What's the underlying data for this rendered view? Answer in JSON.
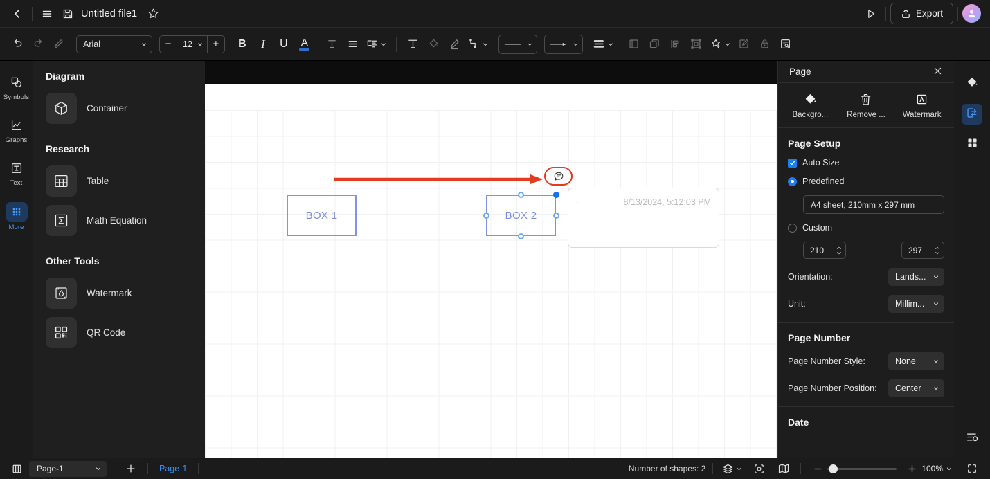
{
  "titlebar": {
    "back_icon": "chevron-left-icon",
    "menu_icon": "hamburger-menu-icon",
    "save_icon": "floppy-save-icon",
    "doc_title": "Untitled file1",
    "favorite_icon": "star-icon",
    "present_icon": "play-present-icon",
    "export_label": "Export",
    "export_icon": "share-upload-icon",
    "avatar_icon": "user-avatar-icon"
  },
  "toolbar": {
    "undo_icon": "undo-icon",
    "redo_icon": "redo-icon",
    "format_painter_icon": "format-painter-icon",
    "font_family": "Arial",
    "font_size": "12",
    "decrease_label": "−",
    "increase_label": "+",
    "bold_label": "B",
    "italic_label": "I",
    "underline_label": "U",
    "font_color_label": "A",
    "font_color_accent": "#2f6fd0",
    "text_effect_icon": "text-effect-icon",
    "align_icon": "text-align-icon",
    "line_spacing_icon": "line-spacing-icon",
    "text_box_icon": "text-box-icon",
    "fill_icon": "fill-color-icon",
    "pen_icon": "pen-line-icon",
    "connector_icon": "connector-icon",
    "line_style_icon": "line-style-icon",
    "arrow_style_icon": "arrow-style-icon",
    "line_weight_icon": "line-weight-icon",
    "frame_icon": "frame-icon",
    "duplicate_icon": "duplicate-icon",
    "align_objects_icon": "align-objects-icon",
    "group_icon": "group-icon",
    "effects_icon": "magic-effects-icon",
    "edit_icon": "edit-pencil-icon",
    "lock_icon": "lock-icon",
    "find_icon": "find-replace-icon"
  },
  "left_rail": {
    "items": [
      {
        "label": "Symbols",
        "icon": "symbols-shapes-icon",
        "active": false
      },
      {
        "label": "Graphs",
        "icon": "graphs-chart-icon",
        "active": false
      },
      {
        "label": "Text",
        "icon": "text-box-icon",
        "active": false
      },
      {
        "label": "More",
        "icon": "more-grid-dots-icon",
        "active": true
      }
    ]
  },
  "left_panel": {
    "sections": [
      {
        "title": "Diagram",
        "items": [
          {
            "label": "Container",
            "icon": "cube-container-icon"
          }
        ]
      },
      {
        "title": "Research",
        "items": [
          {
            "label": "Table",
            "icon": "table-grid-icon"
          },
          {
            "label": "Math Equation",
            "icon": "sigma-math-icon"
          }
        ]
      },
      {
        "title": "Other Tools",
        "items": [
          {
            "label": "Watermark",
            "icon": "watermark-icon"
          },
          {
            "label": "QR Code",
            "icon": "qr-code-icon"
          }
        ]
      }
    ]
  },
  "canvas": {
    "shapes": [
      {
        "label": "BOX 1",
        "selected": false
      },
      {
        "label": "BOX 2",
        "selected": true
      }
    ],
    "shape_stroke_color": "#8093e8",
    "handle_color": "#6ba8f0",
    "note": {
      "prefix": ":",
      "timestamp": "8/13/2024, 5:12:03 PM"
    },
    "annotation": {
      "arrow_color": "#e23b1e",
      "highlight_color": "#e23b1e",
      "comment_icon": "comment-bubble-icon"
    }
  },
  "right_panel": {
    "title": "Page",
    "close_icon": "close-x-icon",
    "tools": [
      {
        "label": "Backgro...",
        "icon": "paint-bucket-icon"
      },
      {
        "label": "Remove ...",
        "icon": "trash-delete-icon"
      },
      {
        "label": "Watermark",
        "icon": "watermark-a-icon"
      }
    ],
    "page_setup": {
      "heading": "Page Setup",
      "auto_size_label": "Auto Size",
      "auto_size_checked": true,
      "predefined_label": "Predefined",
      "predefined_selected": true,
      "predefined_value": "A4 sheet, 210mm x 297 mm",
      "custom_label": "Custom",
      "custom_selected": false,
      "width_value": "210",
      "height_value": "297",
      "orientation_label": "Orientation:",
      "orientation_value": "Lands...",
      "unit_label": "Unit:",
      "unit_value": "Millim..."
    },
    "page_number": {
      "heading": "Page Number",
      "style_label": "Page Number Style:",
      "style_value": "None",
      "position_label": "Page Number Position:",
      "position_value": "Center"
    },
    "date": {
      "heading": "Date"
    }
  },
  "right_rail": {
    "items": [
      {
        "icon": "paint-bucket-icon",
        "active": false
      },
      {
        "icon": "page-properties-icon",
        "active": true
      },
      {
        "icon": "grid-apps-icon",
        "active": false
      }
    ],
    "bottom_icon": "settings-sliders-icon"
  },
  "status_bar": {
    "panel_toggle_icon": "panel-toggle-icon",
    "page_select_value": "Page-1",
    "add_page_label": "+",
    "page_tab_label": "Page-1",
    "shape_count_text": "Number of shapes: 2",
    "layers_icon": "layers-icon",
    "focus_icon": "focus-target-icon",
    "map_icon": "map-overview-icon",
    "zoom_out_label": "−",
    "zoom_in_label": "+",
    "zoom_value": "100%",
    "fullscreen_icon": "fullscreen-icon"
  }
}
